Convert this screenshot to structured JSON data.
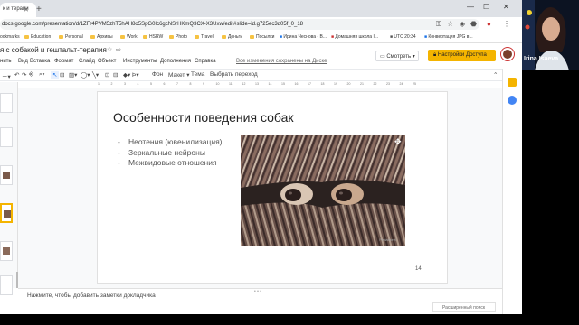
{
  "browser": {
    "tab_title": "к и терапи",
    "url": "docs.google.com/presentation/d/1ZFr4PVM5zhT5hAH8o5SpG0Ic6gcNSrHKmQ3CX-X3Uxw/edit#slide=id.g725ec3d05f_0_18",
    "bookmarks": [
      {
        "label": "ookmarks",
        "folder": false
      },
      {
        "label": "Education",
        "folder": true
      },
      {
        "label": "Personal",
        "folder": true
      },
      {
        "label": "Архивы",
        "folder": true
      },
      {
        "label": "Work",
        "folder": true
      },
      {
        "label": "HSRW",
        "folder": true
      },
      {
        "label": "Photo",
        "folder": true
      },
      {
        "label": "Travel",
        "folder": true
      },
      {
        "label": "Деньги",
        "folder": true
      },
      {
        "label": "Посылки",
        "folder": true
      },
      {
        "label": "Ирина Чеснова - В...",
        "folder": false
      },
      {
        "label": "Домашняя школа I...",
        "folder": false
      },
      {
        "label": "UTC 20:34",
        "folder": false
      },
      {
        "label": "Конвертация JPG в...",
        "folder": false
      }
    ]
  },
  "docs": {
    "title": "я с собакой и гештальт-терапия",
    "menu": [
      "нить",
      "Вид",
      "Вставка",
      "Формат",
      "Слайд",
      "Объект",
      "Инструменты",
      "Дополнения",
      "Справка"
    ],
    "saved_message": "Все изменения сохранены на Диске",
    "present_label": "Смотреть",
    "share_label": "Настройки Доступа",
    "toolbar_items": [
      "Фон",
      "Макет ▾",
      "Тема",
      "Выбрать переход"
    ],
    "ruler_ticks": [
      "1",
      "2",
      "3",
      "4",
      "5",
      "6",
      "7",
      "8",
      "9",
      "10",
      "11",
      "12",
      "13",
      "14",
      "15",
      "16",
      "17",
      "18",
      "19",
      "20",
      "21",
      "22",
      "23",
      "24",
      "25"
    ]
  },
  "slide": {
    "title": "Особенности поведения собак",
    "bullets": [
      "Неотения (ювенилизация)",
      "Зеркальные нейроны",
      "Межвидовые отношения"
    ],
    "photo_watermark": "Pedalsteel",
    "number": "14"
  },
  "notes": {
    "placeholder": "Нажмите, чтобы добавить заметки докладчика",
    "explore_label": "Расширенный поиск"
  },
  "webcam": {
    "name": "Irina Isaeva"
  },
  "colors": {
    "share_button": "#f4b400",
    "selected_thumb": "#f4b400",
    "folder": "#f6c343"
  }
}
